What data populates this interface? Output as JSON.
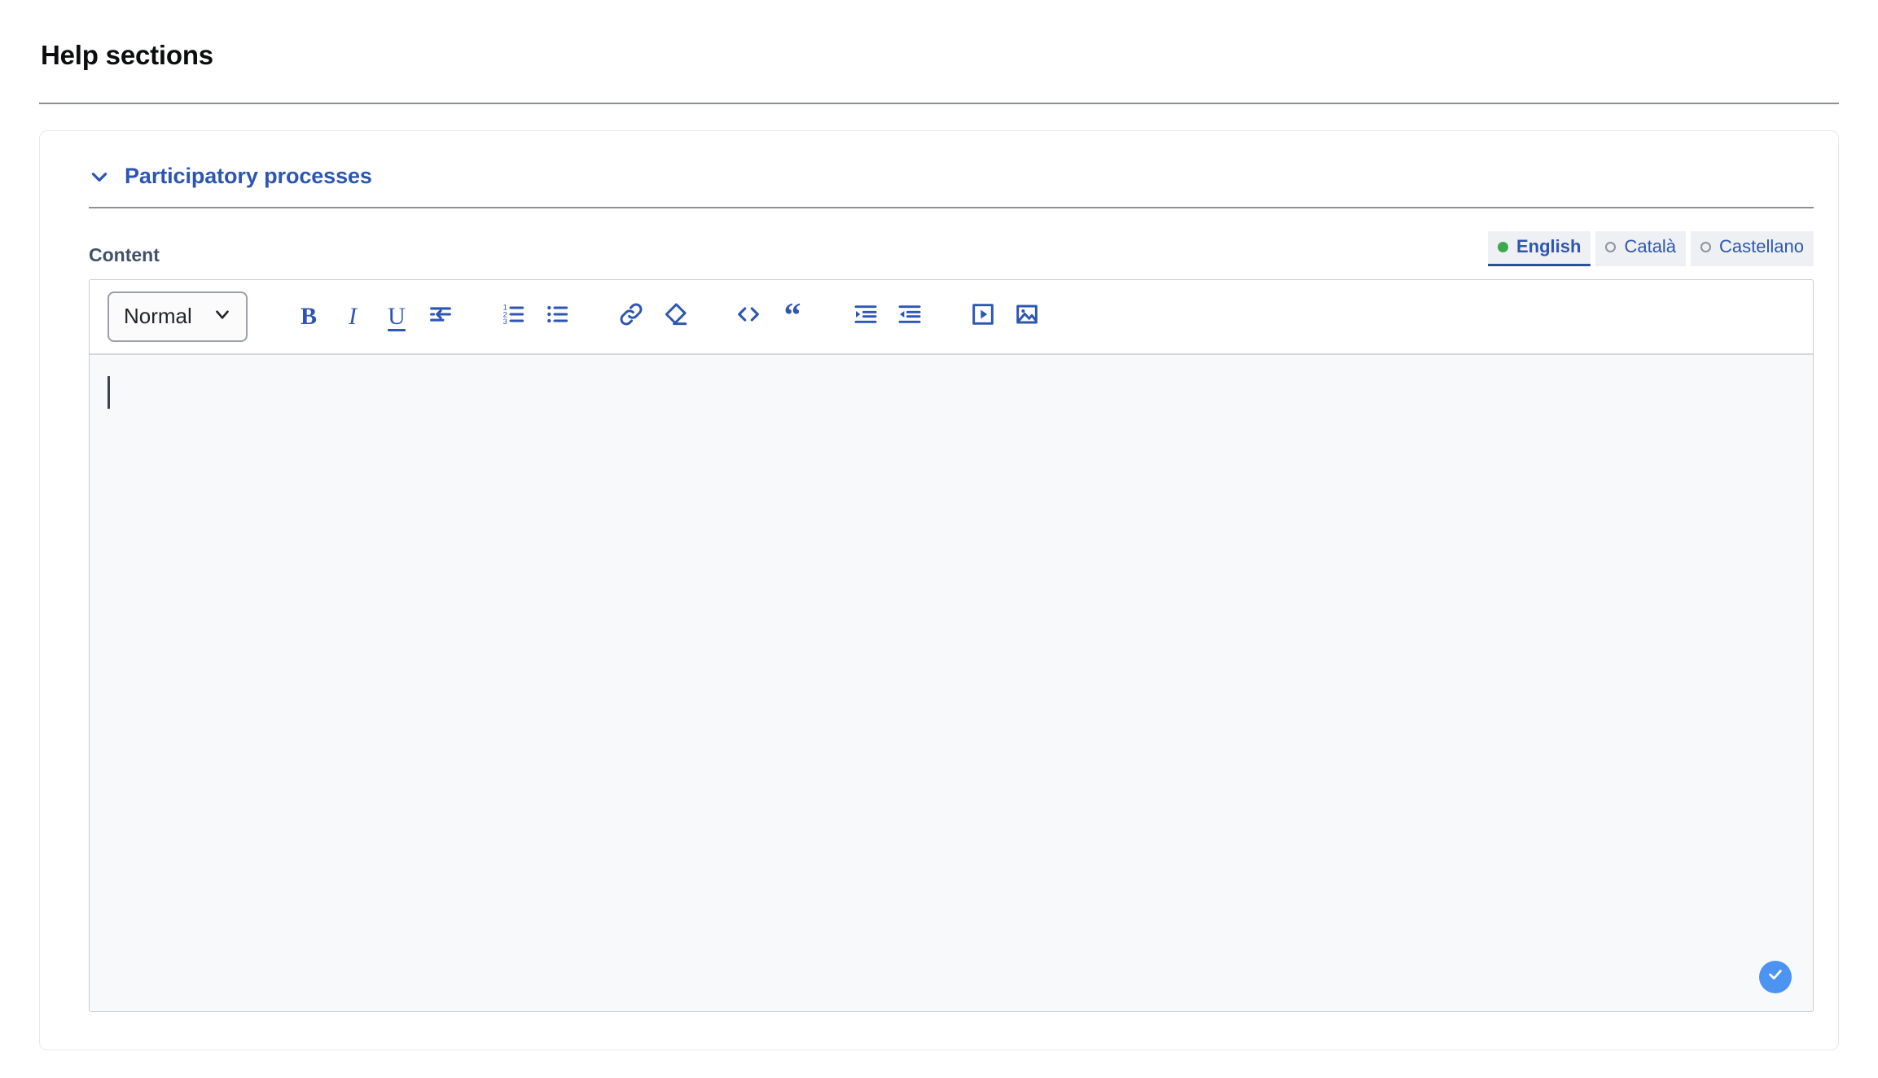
{
  "page": {
    "title": "Help sections"
  },
  "section": {
    "title": "Participatory processes",
    "chevron_icon": "chevron-down-icon",
    "expanded": true
  },
  "content": {
    "label": "Content",
    "editor_text": "",
    "caret_visible": true
  },
  "languages": [
    {
      "label": "English",
      "active": true,
      "dot": "filled"
    },
    {
      "label": "Català",
      "active": false,
      "dot": "hollow"
    },
    {
      "label": "Castellano",
      "active": false,
      "dot": "hollow"
    }
  ],
  "toolbar": {
    "style_select": {
      "value": "Normal",
      "chevron_icon": "chevron-down-icon"
    },
    "buttons": [
      {
        "name": "bold-button",
        "glyph": "B",
        "icon": "bold-icon"
      },
      {
        "name": "italic-button",
        "glyph": "I",
        "icon": "italic-icon"
      },
      {
        "name": "underline-button",
        "glyph": "U",
        "icon": "underline-icon"
      },
      {
        "name": "hard-break-button",
        "glyph": "",
        "icon": "hard-break-icon"
      },
      {
        "name": "ordered-list-button",
        "glyph": "",
        "icon": "ordered-list-icon"
      },
      {
        "name": "bullet-list-button",
        "glyph": "",
        "icon": "bullet-list-icon"
      },
      {
        "name": "link-button",
        "glyph": "",
        "icon": "link-icon"
      },
      {
        "name": "clear-format-button",
        "glyph": "",
        "icon": "eraser-icon"
      },
      {
        "name": "code-block-button",
        "glyph": "<>",
        "icon": "code-icon"
      },
      {
        "name": "blockquote-button",
        "glyph": "“",
        "icon": "quote-icon"
      },
      {
        "name": "indent-button",
        "glyph": "",
        "icon": "indent-icon"
      },
      {
        "name": "outdent-button",
        "glyph": "",
        "icon": "outdent-icon"
      },
      {
        "name": "video-button",
        "glyph": "",
        "icon": "video-icon"
      },
      {
        "name": "image-button",
        "glyph": "",
        "icon": "image-icon"
      }
    ],
    "confirm_icon": "check-icon"
  },
  "colors": {
    "accent_blue": "#2d56b2",
    "active_underline": "#2d4f9e",
    "confirm_blue": "#4c94f2",
    "status_green": "#3ca94b",
    "editor_bg": "#f8f9fb",
    "tab_bg": "#eef0f4"
  }
}
